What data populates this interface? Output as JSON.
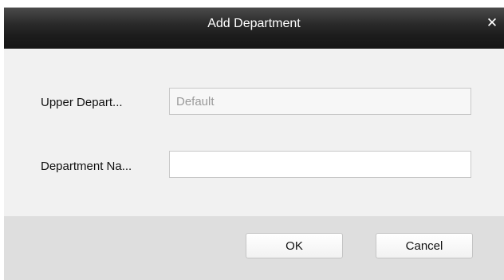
{
  "dialog": {
    "title": "Add Department",
    "close_glyph": "✕"
  },
  "form": {
    "upper_department_label": "Upper Depart...",
    "upper_department_value": "Default",
    "department_name_label": "Department Na...",
    "department_name_value": ""
  },
  "buttons": {
    "ok_label": "OK",
    "cancel_label": "Cancel"
  },
  "icons": {
    "close": "close-icon"
  },
  "colors": {
    "titlebar": "#1c1c1c",
    "body": "#f1f1f1",
    "footer": "#dedede"
  }
}
